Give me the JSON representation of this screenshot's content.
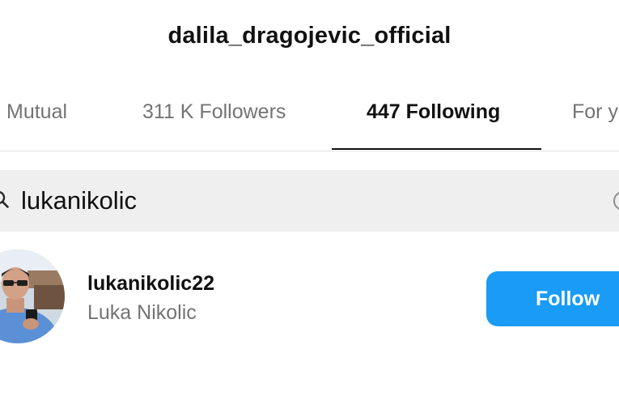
{
  "header": {
    "title": "dalila_dragojevic_official"
  },
  "tabs": [
    {
      "label": "Mutual",
      "active": false
    },
    {
      "label": "311 K Followers",
      "active": false
    },
    {
      "label": "447 Following",
      "active": true
    },
    {
      "label": "For y",
      "active": false
    }
  ],
  "search": {
    "value": "lukanikolic",
    "icon": "search-icon",
    "clear_icon": "clear-icon"
  },
  "results": [
    {
      "username": "lukanikolic22",
      "full_name": "Luka Nikolic",
      "button_label": "Follow"
    }
  ],
  "colors": {
    "accent": "#1a9bf5",
    "secondary_text": "#737373",
    "search_bg": "#efefef"
  }
}
